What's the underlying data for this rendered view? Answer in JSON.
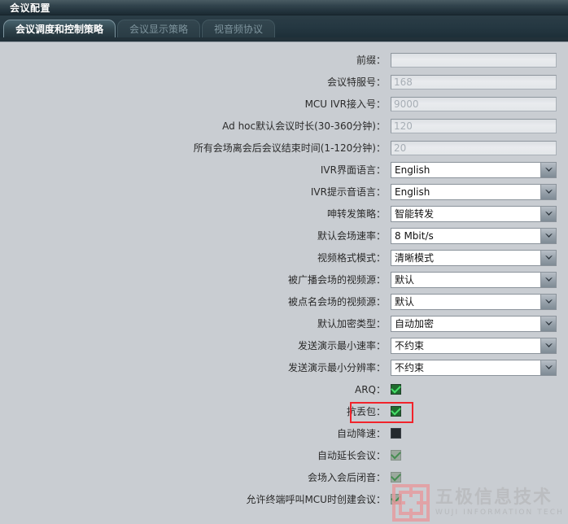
{
  "window": {
    "title": "会议配置"
  },
  "tabs": [
    {
      "label": "会议调度和控制策略",
      "active": true
    },
    {
      "label": "会议显示策略",
      "active": false
    },
    {
      "label": "视音频协议",
      "active": false
    }
  ],
  "form": {
    "colon": "：",
    "text_fields": [
      {
        "label": "前缀",
        "value": "",
        "placeholder": ""
      },
      {
        "label": "会议特服号",
        "value": "168",
        "placeholder": ""
      },
      {
        "label": "MCU IVR接入号",
        "value": "9000",
        "placeholder": ""
      },
      {
        "label": "Ad hoc默认会议时长(30-360分钟)",
        "value": "120",
        "placeholder": ""
      },
      {
        "label": "所有会场离会后会议结束时间(1-120分钟)",
        "value": "20",
        "placeholder": ""
      }
    ],
    "selects": [
      {
        "label": "IVR界面语言",
        "value": "English"
      },
      {
        "label": "IVR提示音语言",
        "value": "English"
      },
      {
        "label": "呻转发策略",
        "value": "智能转发"
      },
      {
        "label": "默认会场速率",
        "value": "8 Mbit/s"
      },
      {
        "label": "视频格式模式",
        "value": "清晰模式"
      },
      {
        "label": "被广播会场的视频源",
        "value": "默认"
      },
      {
        "label": "被点名会场的视频源",
        "value": "默认"
      },
      {
        "label": "默认加密类型",
        "value": "自动加密"
      },
      {
        "label": "发送演示最小速率",
        "value": "不约束"
      },
      {
        "label": "发送演示最小分辨率",
        "value": "不约束"
      }
    ],
    "checkboxes": [
      {
        "label": "ARQ",
        "checked": true,
        "state": "enabled"
      },
      {
        "label": "抗丢包",
        "checked": true,
        "state": "enabled",
        "highlighted": true
      },
      {
        "label": "自动降速",
        "checked": false,
        "state": "enabled"
      },
      {
        "label": "自动延长会议",
        "checked": true,
        "state": "dim"
      },
      {
        "label": "会场入会后闭音",
        "checked": true,
        "state": "dim"
      },
      {
        "label": "允许终端呼叫MCU时创建会议",
        "checked": true,
        "state": "dim"
      }
    ]
  },
  "watermark": {
    "cn": "五极信息技术",
    "en": "WUJI INFORMATION TECH"
  },
  "colors": {
    "titlebar": "#23343d",
    "tab_active_text": "#ffffff",
    "tab_inactive_text": "#7e949d",
    "page_bg": "#c9cdd2",
    "highlight": "#f1232b",
    "checkbox_green": "#1f6b2e"
  }
}
